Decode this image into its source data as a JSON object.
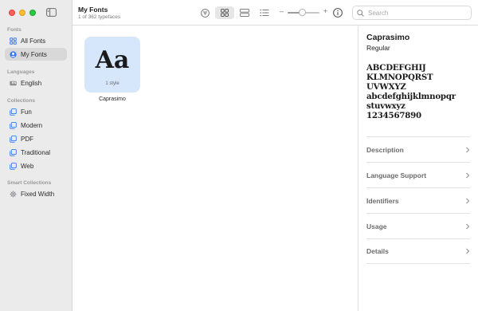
{
  "window": {
    "controls": [
      "close",
      "minimize",
      "zoom"
    ]
  },
  "sidebar": {
    "sections": [
      {
        "heading": "Fonts",
        "items": [
          {
            "label": "All Fonts",
            "icon": "grid-icon",
            "selected": false
          },
          {
            "label": "My Fonts",
            "icon": "person-icon",
            "selected": true
          }
        ]
      },
      {
        "heading": "Languages",
        "items": [
          {
            "label": "English",
            "icon": "language-badge-icon",
            "badge": "EN",
            "selected": false
          }
        ]
      },
      {
        "heading": "Collections",
        "items": [
          {
            "label": "Fun",
            "icon": "collection-icon",
            "selected": false
          },
          {
            "label": "Modern",
            "icon": "collection-icon",
            "selected": false
          },
          {
            "label": "PDF",
            "icon": "collection-icon",
            "selected": false
          },
          {
            "label": "Traditional",
            "icon": "collection-icon",
            "selected": false
          },
          {
            "label": "Web",
            "icon": "collection-icon",
            "selected": false
          }
        ]
      },
      {
        "heading": "Smart Collections",
        "items": [
          {
            "label": "Fixed Width",
            "icon": "gear-icon",
            "selected": false
          }
        ]
      }
    ]
  },
  "toolbar": {
    "title": "My Fonts",
    "subtitle": "1 of 362 typefaces",
    "view_mode": "grid",
    "size_minus": "–",
    "size_plus": "+",
    "preview_size_fraction": 0.45,
    "search_placeholder": "Search"
  },
  "fonts": [
    {
      "name": "Caprasimo",
      "sample": "Aa",
      "styles": "1 style"
    }
  ],
  "detail": {
    "name": "Caprasimo",
    "style": "Regular",
    "preview": "ABCDEFGHIJ\nKLMNOPQRST\nUVWXYZ\nabcdefghijklmnopqr\nstuvwxyz\n1234567890",
    "sections": [
      "Description",
      "Language Support",
      "Identifiers",
      "Usage",
      "Details"
    ]
  },
  "colors": {
    "sidebar_bg": "#ebebeb",
    "selected_item": "#d8d8d8",
    "tile_bg": "#d6e6fb",
    "accent": "#3478f6"
  }
}
